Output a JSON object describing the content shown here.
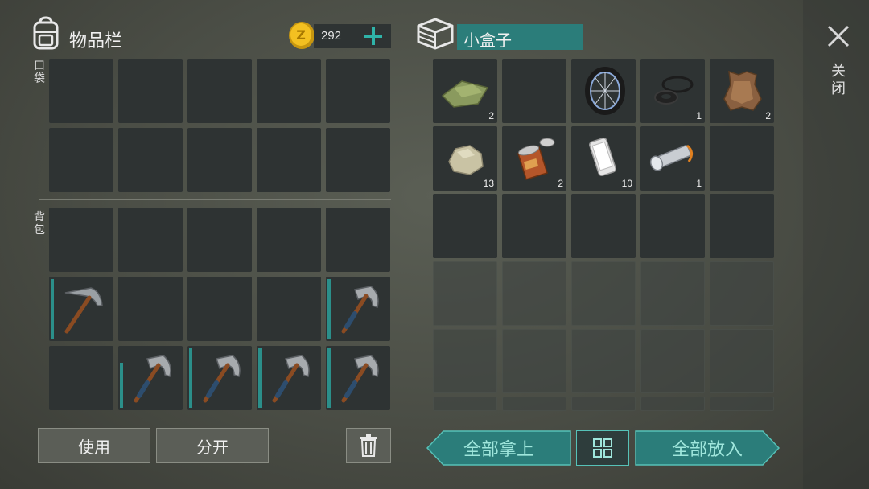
{
  "inventory": {
    "title": "物品栏",
    "coins": "292",
    "pocket_label": "口袋",
    "backpack_label": "背包"
  },
  "container": {
    "name": "小盒子",
    "items": [
      {
        "name": "cloth",
        "qty": "2"
      },
      {
        "name": "wheel",
        "qty": ""
      },
      {
        "name": "rubber-ring",
        "qty": "1"
      },
      {
        "name": "leather-hide",
        "qty": "2"
      },
      {
        "name": "stone",
        "qty": "13"
      },
      {
        "name": "tin-can",
        "qty": "2"
      },
      {
        "name": "phone",
        "qty": "10"
      },
      {
        "name": "flashlight",
        "qty": "1"
      }
    ]
  },
  "close_label": "关闭",
  "buttons": {
    "use": "使用",
    "split": "分开",
    "take_all": "全部拿上",
    "put_all": "全部放入"
  },
  "colors": {
    "accent": "#2b8f8a",
    "slot": "#2e3333"
  },
  "icons": [
    "backpack-icon",
    "coin-icon",
    "plus-icon",
    "box-icon",
    "close-icon",
    "trash-icon",
    "sort-icon",
    "pickaxe-icon"
  ]
}
